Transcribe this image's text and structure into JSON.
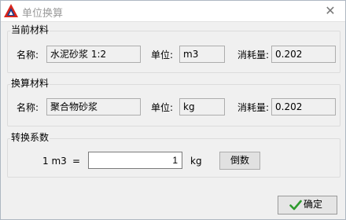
{
  "window": {
    "title": "单位换算"
  },
  "current_material": {
    "group_title": "当前材料",
    "name_label": "名称:",
    "name_value": "水泥砂浆 1:2",
    "unit_label": "单位:",
    "unit_value": "m3",
    "consumption_label": "消耗量:",
    "consumption_value": "0.202"
  },
  "converted_material": {
    "group_title": "换算材料",
    "name_label": "名称:",
    "name_value": "聚合物砂浆",
    "unit_label": "单位:",
    "unit_value": "kg",
    "consumption_label": "消耗量:",
    "consumption_value": "0.202"
  },
  "conversion": {
    "group_title": "转换系数",
    "from_text": "1 m3",
    "equals": "=",
    "factor_value": "1",
    "to_unit": "kg",
    "reciprocal_button": "倒数"
  },
  "footer": {
    "ok_button": "确定"
  },
  "colors": {
    "ok_check": "#2e9b2e",
    "icon_red": "#d9261c",
    "icon_blue": "#1f3f8f"
  }
}
